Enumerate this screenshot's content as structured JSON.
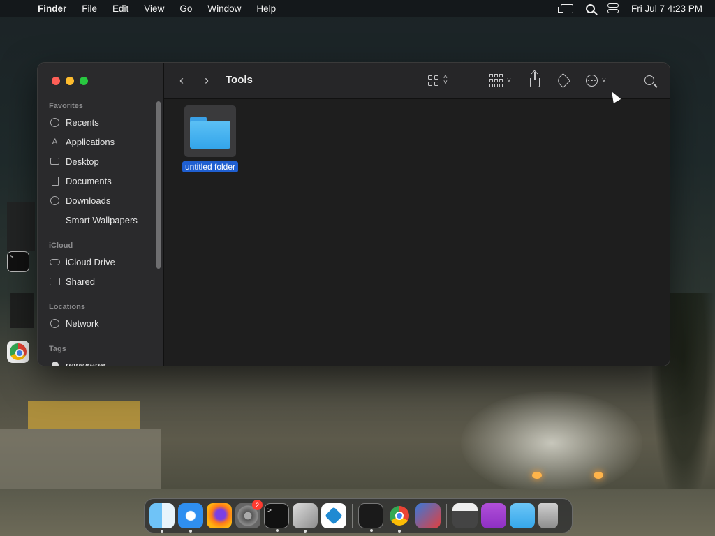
{
  "menubar": {
    "app_name": "Finder",
    "menus": [
      "File",
      "Edit",
      "View",
      "Go",
      "Window",
      "Help"
    ],
    "clock": "Fri Jul 7  4:23 PM"
  },
  "window": {
    "title": "Tools",
    "sidebar": {
      "favorites_header": "Favorites",
      "favorites": [
        "Recents",
        "Applications",
        "Desktop",
        "Documents",
        "Downloads",
        "Smart Wallpapers"
      ],
      "icloud_header": "iCloud",
      "icloud": [
        "iCloud Drive",
        "Shared"
      ],
      "locations_header": "Locations",
      "locations": [
        "Network"
      ],
      "tags_header": "Tags",
      "tags": [
        "rewwrerer"
      ]
    },
    "items": [
      {
        "name": "untitled folder",
        "selected": true
      }
    ]
  },
  "dock": {
    "apps": [
      "finder",
      "safari",
      "firefox",
      "system-settings",
      "terminal",
      "ruler-app",
      "vscode",
      "activity-monitor",
      "chrome",
      "rocket-app",
      "window-app",
      "purple-folder",
      "blue-folder",
      "trash"
    ],
    "badge": "2"
  },
  "left_edge": {
    "terminal_prompt": ">_"
  }
}
